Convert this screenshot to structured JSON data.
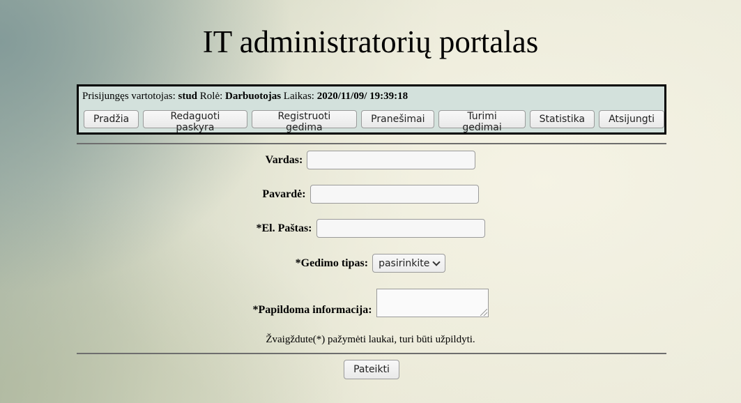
{
  "page": {
    "title": "IT administratorių portalas"
  },
  "userbar": {
    "user_label": "Prisijungęs vartotojas: ",
    "user_value": "stud",
    "role_label": " Rolė: ",
    "role_value": "Darbuotojas",
    "time_label": " Laikas: ",
    "time_value": "2020/11/09/ 19:39:18"
  },
  "nav": {
    "items": [
      {
        "label": "Pradžia"
      },
      {
        "label": "Redaguoti paskyra"
      },
      {
        "label": "Registruoti gedima"
      },
      {
        "label": "Pranešimai"
      },
      {
        "label": "Turimi gedimai"
      },
      {
        "label": "Statistika"
      },
      {
        "label": "Atsijungti"
      }
    ]
  },
  "form": {
    "fields": [
      {
        "label": "Vardas:",
        "value": ""
      },
      {
        "label": "Pavardė:",
        "value": ""
      },
      {
        "label": "*El. Paštas:",
        "value": ""
      }
    ],
    "fault_type": {
      "label": "*Gedimo tipas:",
      "selected": "pasirinkite"
    },
    "additional_info": {
      "label": "*Papildoma informacija:",
      "value": ""
    },
    "note": "Žvaigždute(*) pažymėti laukai, turi būti užpildyti.",
    "submit_label": "Pateikti"
  }
}
